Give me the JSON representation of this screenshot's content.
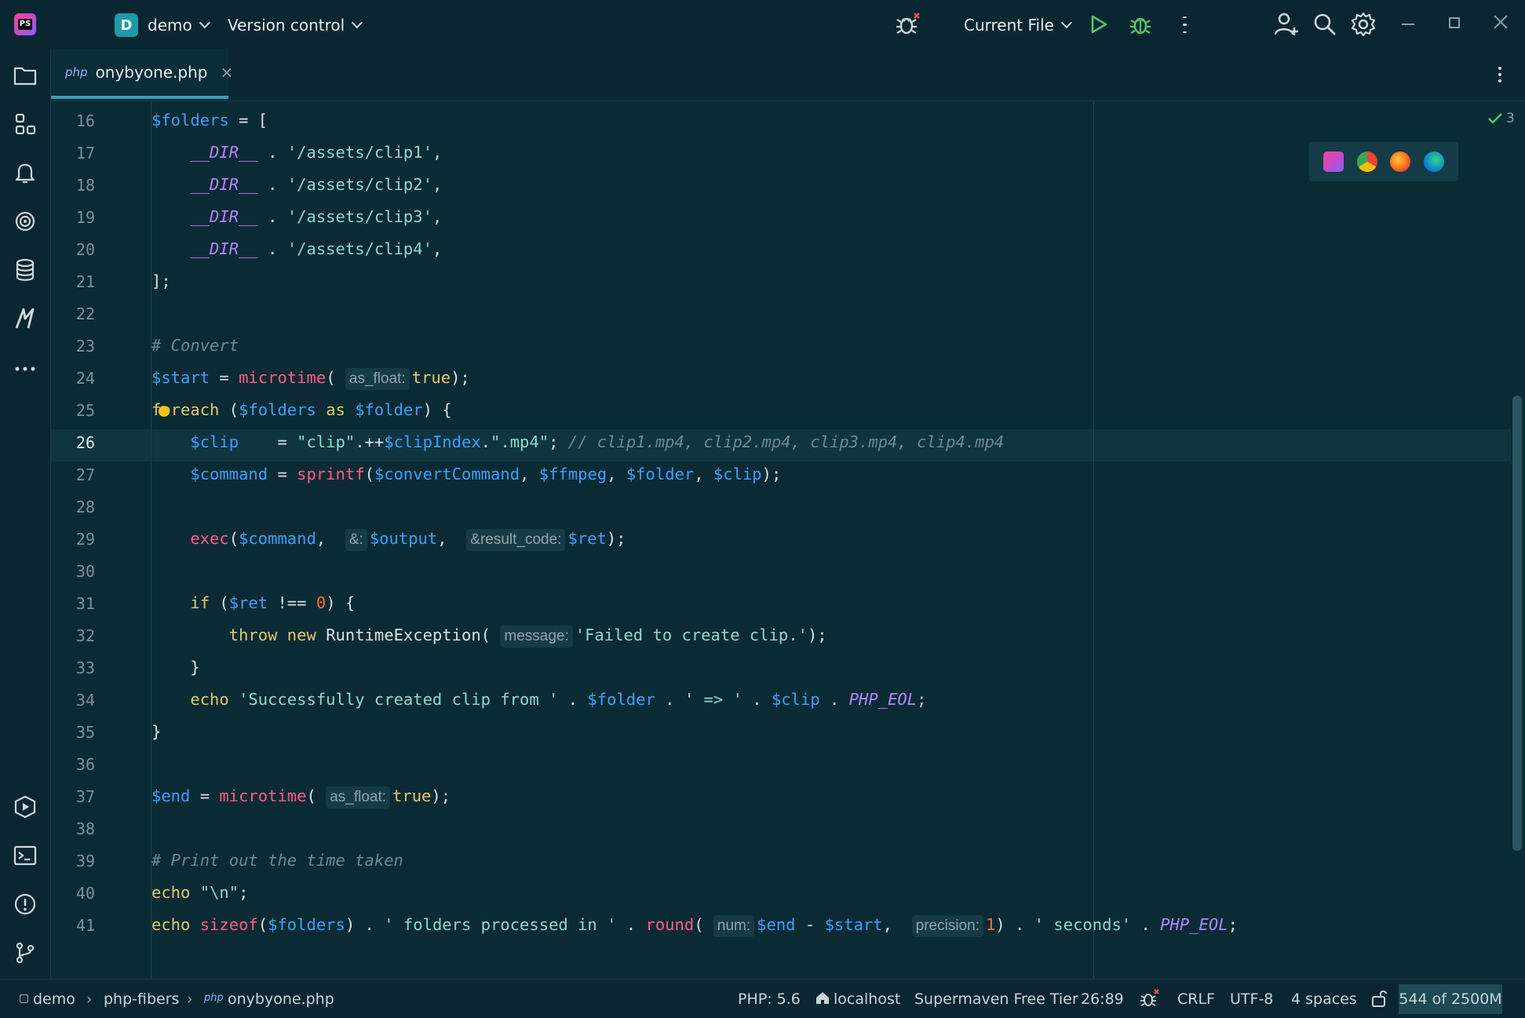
{
  "titlebar": {
    "logo_text": "PS",
    "project_badge": "D",
    "project_name": "demo",
    "version_control": "Version control",
    "run_config": "Current File"
  },
  "tab": {
    "lang_badge": "php",
    "file_name": "onybyone.php",
    "close_glyph": "×"
  },
  "editor": {
    "inspection_count": "3",
    "line_numbers": [
      "16",
      "17",
      "18",
      "19",
      "20",
      "21",
      "22",
      "23",
      "24",
      "25",
      "26",
      "27",
      "28",
      "29",
      "30",
      "31",
      "32",
      "33",
      "34",
      "35",
      "36",
      "37",
      "38",
      "39",
      "40",
      "41"
    ],
    "current_line": "26",
    "hints": {
      "as_float": "as_float:",
      "ref": "&:",
      "result_code": "&result_code:",
      "message": "message:",
      "num": "num:",
      "precision": "precision:"
    }
  },
  "statusbar": {
    "breadcrumb": [
      "demo",
      "php-fibers",
      "onybyone.php"
    ],
    "php_version": "PHP: 5.6",
    "server": "localhost",
    "plugin": "Supermaven Free Tier",
    "position": "26:89",
    "line_ending": "CRLF",
    "encoding": "UTF-8",
    "indent": "4 spaces",
    "memory": "544 of 2500M"
  },
  "colors": {
    "background": "#0b2b34",
    "variable": "#3aa0ff",
    "string": "#8fd8c9",
    "keyword": "#e0c86a",
    "function": "#ff5a8a",
    "comment": "#6c8a91",
    "number": "#ff6a3d",
    "constant": "#b085ff"
  },
  "icons": [
    "phpstorm-logo",
    "menu-icon",
    "bug-icon",
    "run-icon",
    "debug-icon",
    "more-icon",
    "add-user-icon",
    "search-icon",
    "gear-icon",
    "folder-icon",
    "structure-icon",
    "bell-icon",
    "ai-icon",
    "database-icon",
    "jetbrains-ai-icon",
    "more-tools-icon",
    "services-icon",
    "terminal-icon",
    "problems-icon",
    "git-icon"
  ]
}
